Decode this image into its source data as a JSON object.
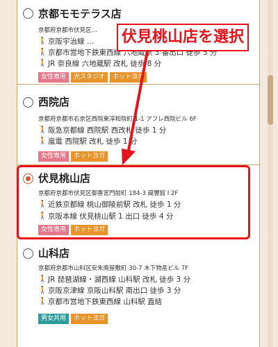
{
  "stores": [
    {
      "name": "京都モモテラス店",
      "address": "京都府京都市伏見区…",
      "access": [
        "京阪宇治線 …",
        "京都市営地下鉄東西線 六地蔵駅 3 番出口 徒歩 5 分",
        "JR 奈良線 六地蔵駅 改札 徒歩 8 分"
      ],
      "tags": [
        {
          "label": "女性専用",
          "color": "pink"
        },
        {
          "label": "光スタジオ",
          "color": "orange"
        },
        {
          "label": "ホットヨガ",
          "color": "orange"
        }
      ],
      "selected": false
    },
    {
      "name": "西院店",
      "address": "京都府京都市右京区西院東淳和院町 1-1 アフレ西院ビル 6F",
      "access": [
        "阪急京都線 西院駅 西改札 徒歩 1 分",
        "嵐電 西院駅 改札 徒歩 1 分"
      ],
      "tags": [
        {
          "label": "女性専用",
          "color": "pink"
        },
        {
          "label": "ホットヨガ",
          "color": "orange"
        }
      ],
      "selected": false
    },
    {
      "name": "伏見桃山店",
      "address": "京都府京都市伏見区御香宮門前町 184-3 蔵響館 I 2F",
      "access": [
        "近鉄京都線 桃山御陵前駅 改札 徒歩 1 分",
        "京阪本線 伏見桃山駅 1 出口 徒歩 4 分"
      ],
      "tags": [
        {
          "label": "女性専用",
          "color": "pink"
        },
        {
          "label": "ホットヨガ",
          "color": "orange"
        }
      ],
      "selected": true
    },
    {
      "name": "山科店",
      "address": "京都府京都市山科区安朱南屋敷町 30-7 木下物産ビル 7F",
      "access": [
        "JR 琵琶湖線・湖西線 山科駅 改札 徒歩 3 分",
        "京阪京津線 京阪山科駅 南出口 徒歩 3 分",
        "京都市営地下鉄東西線 山科駅 直結"
      ],
      "tags": [
        {
          "label": "男女共用",
          "color": "teal"
        },
        {
          "label": "ホットヨガ",
          "color": "orange"
        }
      ],
      "selected": false
    }
  ],
  "annotation": {
    "callout_text": "伏見桃山店を選択",
    "color": "#e8131a"
  },
  "icons": {
    "access_icon": "walker-icon"
  },
  "colors": {
    "pink": "#e6788b",
    "orange": "#e8932c",
    "teal": "#2f9c9c",
    "radio_selected": "#d9572c",
    "border": "#c9a46a"
  }
}
